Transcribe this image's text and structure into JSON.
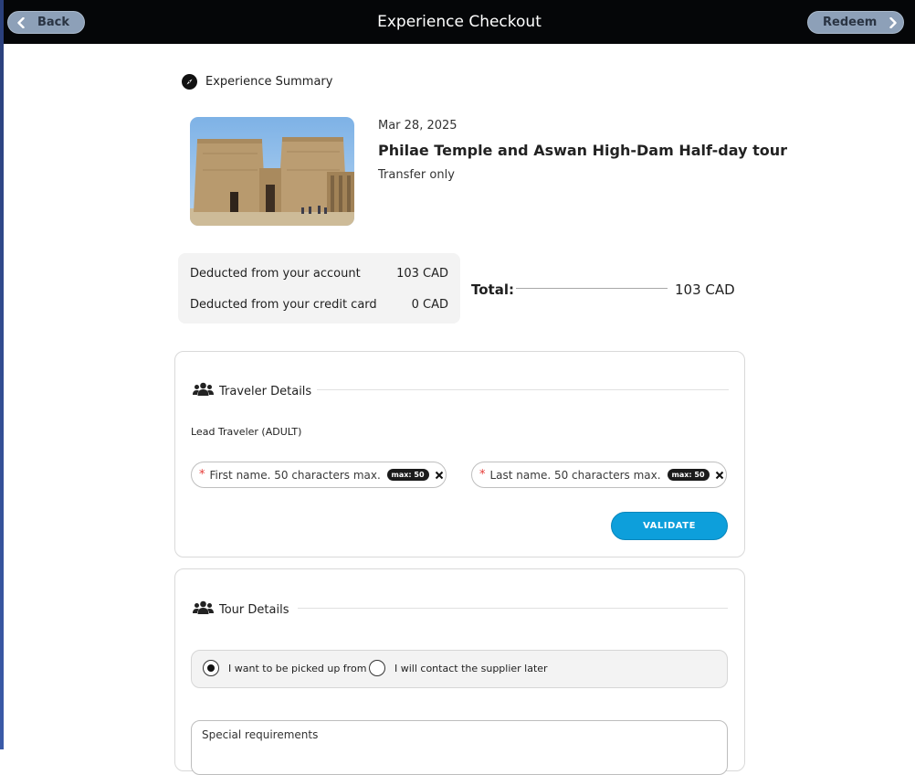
{
  "header": {
    "title": "Experience Checkout",
    "back_label": "Back",
    "redeem_label": "Redeem"
  },
  "summary": {
    "section_title": "Experience Summary",
    "date": "Mar 28, 2025",
    "tour_title": "Philae Temple and Aswan High-Dam Half-day tour",
    "subtitle": "Transfer only",
    "deductions": [
      {
        "label": "Deducted from your account",
        "value": "103 CAD"
      },
      {
        "label": "Deducted from your credit card",
        "value": "0 CAD"
      }
    ],
    "total_label": "Total:",
    "total_value": "103 CAD"
  },
  "traveler": {
    "section_title": "Traveler Details",
    "lead_label": "Lead Traveler (ADULT)",
    "first_name_placeholder": "First name. 50 characters max.",
    "last_name_placeholder": "Last name. 50 characters max.",
    "max_badge": "max: 50",
    "required_mark": "*",
    "validate_label": "VALIDATE"
  },
  "tour": {
    "section_title": "Tour Details",
    "options": [
      {
        "label": "I want to be picked up from",
        "selected": true
      },
      {
        "label": "I will contact the supplier later",
        "selected": false
      }
    ],
    "special_label": "Special requirements"
  },
  "colors": {
    "header_bg": "#050608",
    "nav_button": "#8da0b8",
    "validate_button": "#0d9fdb",
    "required": "#e53935"
  }
}
